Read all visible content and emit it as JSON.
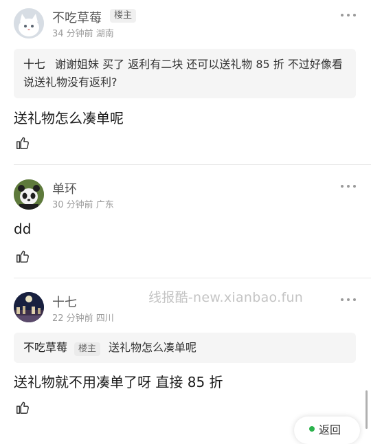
{
  "comments": [
    {
      "author": "不吃草莓",
      "badge": "楼主",
      "meta": "34 分钟前 湖南",
      "avatar_icon": "white-cat-avatar",
      "quote": {
        "author": "十七",
        "text": "谢谢姐妹 买了 返利有二块  还可以送礼物 85 折 不过好像看说送礼物没有返利?"
      },
      "text": "送礼物怎么凑单呢"
    },
    {
      "author": "单环",
      "meta": "30 分钟前 广东",
      "avatar_icon": "panda-avatar",
      "text": "dd"
    },
    {
      "author": "十七",
      "meta": "22 分钟前 四川",
      "avatar_icon": "night-scene-avatar",
      "quote": {
        "author": "不吃草莓",
        "badge": "楼主",
        "text": "送礼物怎么凑单呢"
      },
      "text": "送礼物就不用凑单了呀 直接 85 折"
    }
  ],
  "watermark": "线报酷-new.xianbao.fun",
  "float_button": {
    "label": "返回"
  },
  "colors": {
    "accent": "#2bb24c",
    "divider": "#e8e8e8",
    "quote_bg": "#f5f5f5"
  }
}
